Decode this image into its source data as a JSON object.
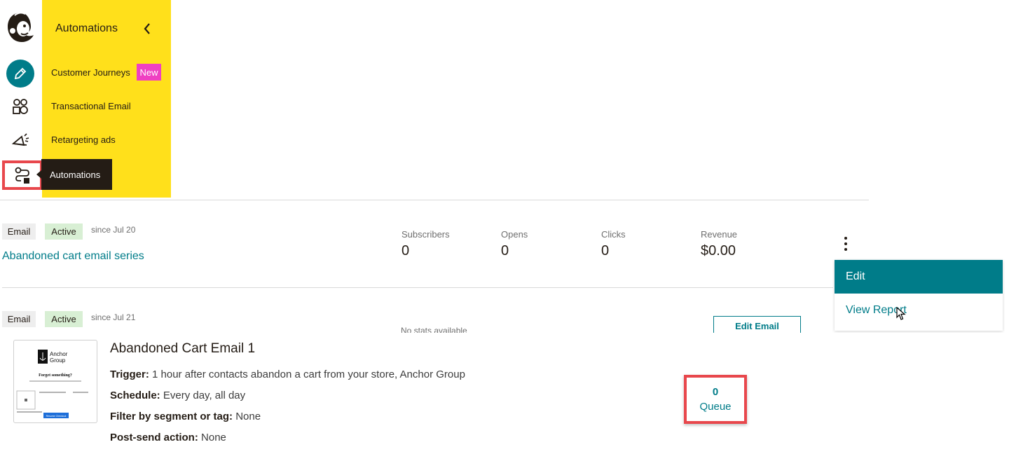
{
  "flyout": {
    "title": "Automations",
    "items": [
      {
        "label": "Customer Journeys",
        "badge": "New"
      },
      {
        "label": "Transactional Email"
      },
      {
        "label": "Retargeting ads"
      }
    ]
  },
  "tooltip": "Automations",
  "rows": [
    {
      "type": "Email",
      "status": "Active",
      "since": "since Jul 20",
      "title": "Abandoned cart email series",
      "stats": [
        {
          "label": "Subscribers",
          "value": "0"
        },
        {
          "label": "Opens",
          "value": "0"
        },
        {
          "label": "Clicks",
          "value": "0"
        },
        {
          "label": "Revenue",
          "value": "$0.00"
        }
      ]
    },
    {
      "type": "Email",
      "status": "Active",
      "since": "since Jul 21",
      "no_stats": "No stats available",
      "edit_button": "Edit Email"
    }
  ],
  "menu": {
    "edit": "Edit",
    "view_report": "View Report"
  },
  "email": {
    "title": "Abandoned Cart Email 1",
    "thumb": {
      "brand": "Anchor",
      "brand_sub": "Group",
      "heading": "Forget something?",
      "button": "Resume Checkout"
    },
    "trigger_label": "Trigger:",
    "trigger_value": "1 hour after contacts abandon a cart from your store, Anchor Group",
    "schedule_label": "Schedule:",
    "schedule_value": "Every day, all day",
    "filter_label": "Filter by segment or tag:",
    "filter_value": "None",
    "post_label": "Post-send action:",
    "post_value": "None",
    "queue_count": "0",
    "queue_label": "Queue"
  },
  "colors": {
    "brand_yellow": "#ffe01b",
    "teal": "#007c89",
    "highlight_red": "#e8474c",
    "badge_pink": "#ef40c2",
    "active_green": "#d8efd4"
  }
}
